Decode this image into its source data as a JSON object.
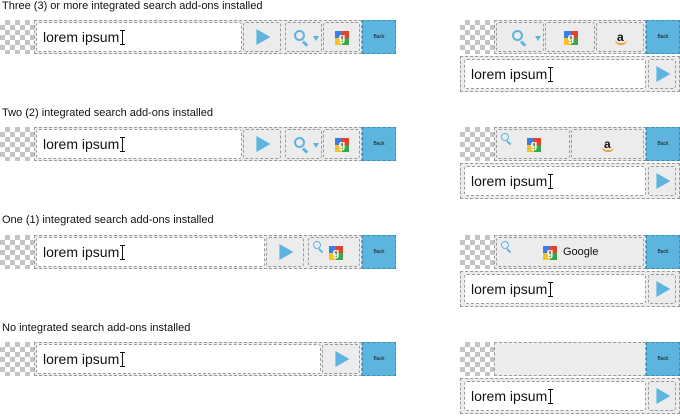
{
  "headings": {
    "three_plus": "Three (3) or more integrated search add-ons installed",
    "two": "Two (2) integrated search add-ons installed",
    "one": "One (1) integrated search add-ons installed",
    "none": "No integrated search add-ons installed"
  },
  "search": {
    "text": "lorem ipsum"
  },
  "back_label": "Back",
  "google_label": "Google",
  "icons": {
    "search": "magnifier-icon",
    "dropdown": "chevron-down-icon",
    "google": "google-icon",
    "amazon": "amazon-icon",
    "go": "play-arrow-icon"
  },
  "colors": {
    "accent": "#5db5df",
    "frame": "#ececec",
    "border": "#9a9a9a"
  }
}
